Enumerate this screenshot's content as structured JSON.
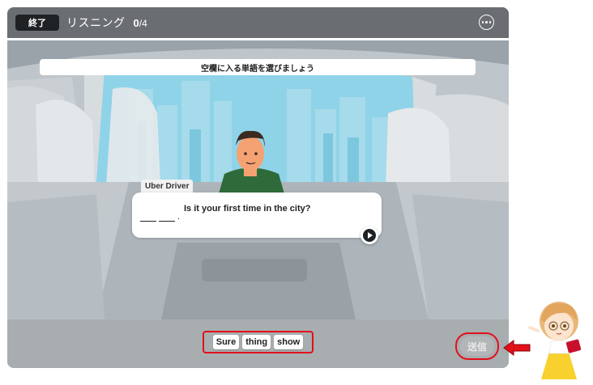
{
  "header": {
    "exit_label": "終了",
    "lesson_title": "リスニング",
    "progress_current": "0",
    "progress_total": "/4"
  },
  "instruction": "空欄に入る単語を選びましょう",
  "dialogue": {
    "speaker": "Uber Driver",
    "sentence": "Is it your first time in the city?",
    "blank_suffix": "."
  },
  "word_bank": [
    "Sure",
    "thing",
    "show"
  ],
  "submit_label": "送信",
  "colors": {
    "highlight": "#e2101a",
    "header": "#6a6e72",
    "window_sky": "#8fd3e8",
    "driver_shirt": "#2f6b3a"
  },
  "icons": {
    "menu": "more-dots-icon",
    "play": "play-icon",
    "arrow": "arrow-left-icon"
  }
}
